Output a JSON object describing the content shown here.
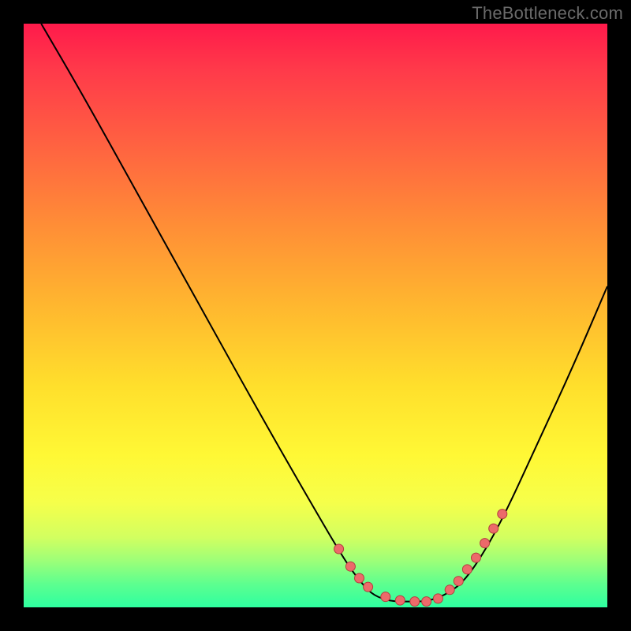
{
  "watermark": "TheBottleneck.com",
  "gradient_colors": {
    "top": "#ff1a4b",
    "mid_upper": "#ff8f36",
    "mid": "#ffdf2c",
    "mid_lower": "#f6ff4a",
    "bottom": "#2effa0"
  },
  "curve_stroke": "#000000",
  "dot_fill": "#ec6a6a",
  "dot_stroke": "#b33e3e",
  "chart_data": {
    "type": "line",
    "title": "",
    "xlabel": "",
    "ylabel": "",
    "xlim": [
      0,
      100
    ],
    "ylim": [
      0,
      100
    ],
    "series": [
      {
        "name": "curve",
        "x": [
          3,
          10,
          20,
          30,
          40,
          48,
          55,
          58,
          60,
          63,
          66,
          69,
          72,
          75,
          78,
          82,
          88,
          94,
          100
        ],
        "y": [
          100,
          88,
          70,
          52,
          34,
          20,
          8,
          4,
          2,
          1,
          1,
          1,
          2,
          4,
          8,
          15,
          28,
          41,
          55
        ]
      },
      {
        "name": "dots",
        "x": [
          54,
          56,
          57.5,
          59,
          62,
          64.5,
          67,
          69,
          71,
          73,
          74.5,
          76,
          77.5,
          79,
          80.5,
          82
        ],
        "y": [
          10,
          7,
          5,
          3.5,
          1.8,
          1.2,
          1,
          1,
          1.5,
          3,
          4.5,
          6.5,
          8.5,
          11,
          13.5,
          16
        ]
      }
    ]
  }
}
